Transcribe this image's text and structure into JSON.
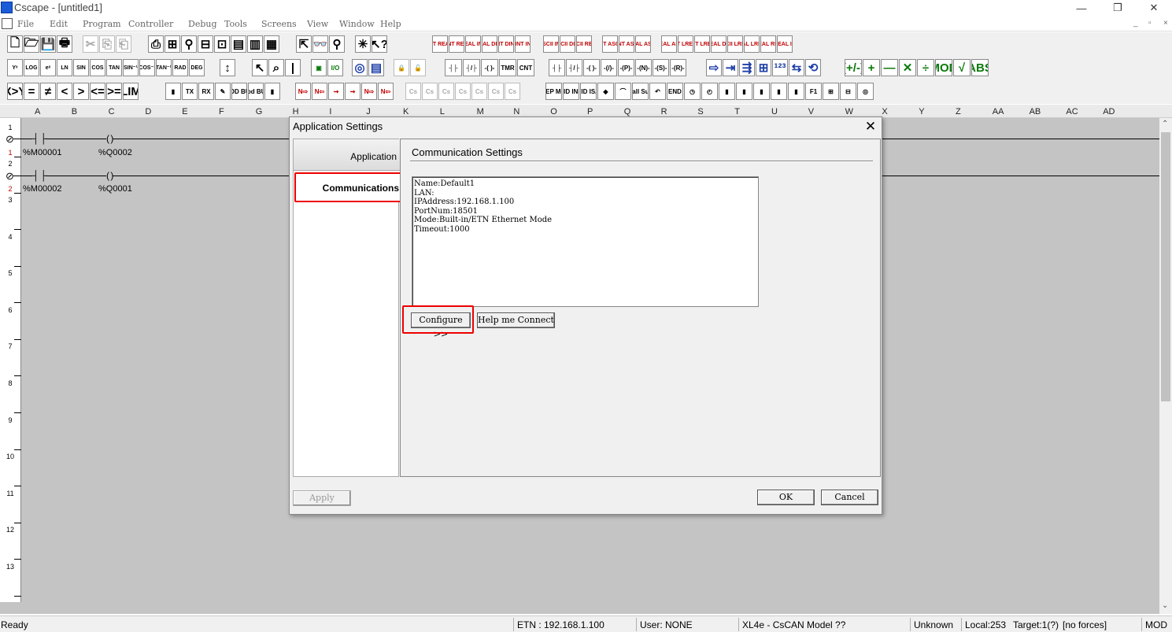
{
  "window": {
    "title": "Cscape - [untitled1]",
    "controls": [
      "—",
      "❐",
      "✕"
    ]
  },
  "menu": [
    "File",
    "Edit",
    "Program",
    "Controller",
    "Debug",
    "Tools",
    "Screens",
    "View",
    "Window",
    "Help"
  ],
  "mdi_controls": [
    "_",
    "▫",
    "×"
  ],
  "toolbar1": {
    "file_buttons": [
      "🗋",
      "🗁",
      "💾",
      "🖶",
      "✂",
      "⎘",
      "⎗",
      "⎙",
      "⊞",
      "⚲",
      "⊟",
      "⊡",
      "▤",
      "▥",
      "▦"
    ],
    "find_buttons": [
      "⇱",
      "👓",
      "⚲",
      "✳",
      "↖?"
    ],
    "convert_buttons": [
      [
        "INT",
        "REAL"
      ],
      [
        "DINT",
        "REAL"
      ],
      [
        "REAL",
        "INT"
      ],
      [
        "REAL",
        "DINT"
      ],
      [
        "INT",
        "DINT"
      ],
      [
        "DINT",
        "INT"
      ],
      [
        "ASCII",
        "INT"
      ],
      [
        "ASCII",
        "DINT"
      ],
      [
        "ASCII",
        "REAL"
      ],
      [
        "INT",
        "ASCII"
      ],
      [
        "DINT",
        "ASCII"
      ],
      [
        "REAL",
        "ASCII"
      ],
      [
        "LREAL",
        "ASCII"
      ],
      [
        "INT",
        "LREAL"
      ],
      [
        "DINT",
        "LREAL"
      ],
      [
        "LREAL",
        "DINT"
      ],
      [
        "ASCII",
        "LREAL"
      ],
      [
        "REAL",
        "LREAL"
      ],
      [
        "LREAL",
        "REAL"
      ],
      [
        "LREAL",
        "INT"
      ]
    ]
  },
  "toolbar2": {
    "math_buttons": [
      "Yˣ",
      "LOG",
      "eˣ",
      "LN",
      "SIN",
      "COS",
      "TAN",
      "SIN⁻¹",
      "COS⁻¹",
      "TAN⁻¹",
      "RAD",
      "DEG",
      "↕"
    ],
    "edit_buttons": [
      "↖",
      "⌕",
      "|",
      "▣",
      "I/O",
      "◎",
      "▤",
      "🔒",
      "🔓"
    ],
    "contact_buttons": [
      "┤├",
      "┤/├",
      "-( )-",
      "TMR",
      "CNT"
    ],
    "coil_buttons": [
      "┤├",
      "┤/├",
      "-( )-",
      "-(/)-",
      "-(P)-",
      "-(N)-",
      "-(S)-",
      "-(R)-"
    ],
    "move_buttons": [
      "⇨",
      "⇥",
      "⇶",
      "⊞",
      "¹²³",
      "⇆",
      "⟲"
    ],
    "arith_buttons": [
      "(+/-)",
      "+",
      "—",
      "✕",
      "÷",
      "MOD",
      "√",
      "ABS"
    ]
  },
  "toolbar3": {
    "compare_buttons": [
      "X>Y",
      "=",
      "≠",
      "<",
      ">",
      "<=",
      ">=",
      "LIM"
    ],
    "comm_buttons": [
      "▮",
      "TX",
      "RX",
      "✎",
      "MOD BUS",
      "Mod BUS",
      "▮"
    ],
    "misc_buttons": [
      "N⇨",
      "N⇦",
      "⇝",
      "⇝",
      "N⇨",
      "N⇦"
    ],
    "gray_buttons": [
      "Cs",
      "Cs",
      "Cs",
      "Cs",
      "Cs",
      "Cs",
      "Cs"
    ],
    "pid_buttons": [
      "STEP MOV",
      "PID IND",
      "PID ISA",
      "◆",
      "⌒",
      "Call Sub",
      "↶",
      "END",
      "◷",
      "◴",
      "▮",
      "▮",
      "▮",
      "▮",
      "▮",
      "F1",
      "⊞",
      "⊟",
      "◎"
    ]
  },
  "ruler": {
    "columns": [
      "A",
      "B",
      "C",
      "D",
      "E",
      "F",
      "G",
      "H",
      "I",
      "J",
      "K",
      "L",
      "M",
      "N",
      "O",
      "P",
      "Q",
      "R",
      "S",
      "T",
      "U",
      "V",
      "W",
      "X",
      "Y",
      "Z",
      "AA",
      "AB",
      "AC",
      "AD"
    ]
  },
  "ladder": {
    "row_numbers": [
      "1",
      "2",
      "3",
      "4",
      "5",
      "6",
      "7",
      "8",
      "9",
      "10",
      "11",
      "12",
      "13"
    ],
    "rungs": [
      {
        "number": "1",
        "contact_symbol": "┤ ├",
        "coil_symbol": "( )",
        "contact_tag": "%M00001",
        "coil_tag": "%Q0002"
      },
      {
        "number": "2",
        "contact_symbol": "┤ ├",
        "coil_symbol": "( )",
        "contact_tag": "%M00002",
        "coil_tag": "%Q0001"
      }
    ]
  },
  "status_bar": {
    "ready": "Ready",
    "connection": "ETN : 192.168.1.100",
    "user": "User: NONE",
    "model": "XL4e - CsCAN Model ??",
    "state": "Unknown",
    "local": "Local:253",
    "target": "Target:1(?)",
    "forces": "[no forces]",
    "mode": "MOD"
  },
  "dialog": {
    "title": "Application Settings",
    "close": "✕",
    "nav": {
      "application": "Application",
      "communications": "Communications"
    },
    "heading": "Communication Settings",
    "info_lines": [
      "Name:Default1",
      "LAN:",
      "IPAddress:192.168.1.100",
      "PortNum:18501",
      "Mode:Built-in/ETN Ethernet Mode",
      "Timeout:1000"
    ],
    "configure_button": "Configure >>",
    "help_button": "Help me Connect",
    "apply_button": "Apply",
    "ok_button": "OK",
    "cancel_button": "Cancel"
  },
  "colors": {
    "highlight": "#e00000",
    "ladder_bg": "#c4c4c4",
    "rung_number": "#c00000"
  }
}
